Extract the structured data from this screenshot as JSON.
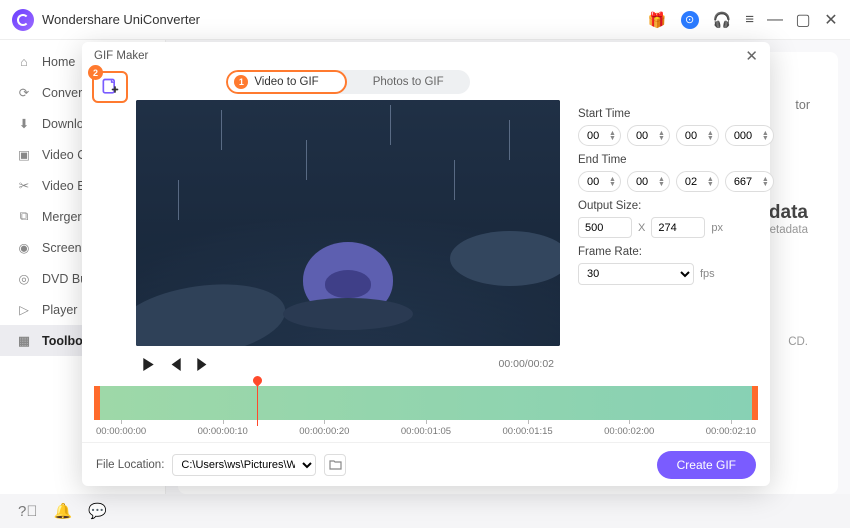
{
  "app": {
    "title": "Wondershare UniConverter"
  },
  "sidebar": {
    "items": [
      {
        "label": "Home"
      },
      {
        "label": "Converter"
      },
      {
        "label": "Downloader"
      },
      {
        "label": "Video Compressor"
      },
      {
        "label": "Video Editor"
      },
      {
        "label": "Merger"
      },
      {
        "label": "Screen Recorder"
      },
      {
        "label": "DVD Burner"
      },
      {
        "label": "Player"
      },
      {
        "label": "Toolbox"
      }
    ]
  },
  "bg": {
    "tr": "tor",
    "title": "data",
    "sub": "etadata",
    "cd": "CD."
  },
  "modal": {
    "title": "GIF Maker",
    "add_badge": "2",
    "tabs": {
      "video": "Video to GIF",
      "photos": "Photos to GIF",
      "active_badge": "1"
    },
    "time_display": "00:00/00:02",
    "settings": {
      "start_label": "Start Time",
      "end_label": "End Time",
      "start": {
        "h": "00",
        "m": "00",
        "s": "00",
        "ms": "000"
      },
      "end": {
        "h": "00",
        "m": "00",
        "s": "02",
        "ms": "667"
      },
      "size_label": "Output Size:",
      "size_w": "500",
      "size_x": "X",
      "size_h": "274",
      "size_unit": "px",
      "rate_label": "Frame Rate:",
      "rate_value": "30",
      "rate_unit": "fps"
    },
    "timeline": {
      "ticks": [
        "00:00:00:00",
        "00:00:00:10",
        "00:00:00:20",
        "00:00:01:05",
        "00:00:01:15",
        "00:00:02:00",
        "00:00:02:10"
      ]
    },
    "footer": {
      "location_label": "File Location:",
      "location_value": "C:\\Users\\ws\\Pictures\\Wondershare",
      "create_label": "Create GIF"
    }
  }
}
